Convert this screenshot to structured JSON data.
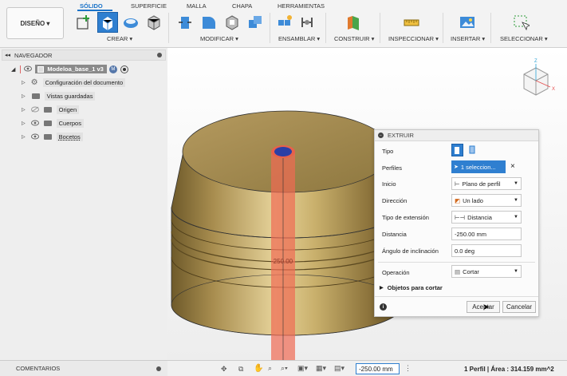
{
  "toolbar": {
    "workspace_label": "DISEÑO ▾",
    "tabs": [
      "SÓLIDO",
      "SUPERFICIE",
      "MALLA",
      "CHAPA",
      "HERRAMIENTAS"
    ],
    "groups": [
      "CREAR ▾",
      "MODIFICAR ▾",
      "ENSAMBLAR ▾",
      "CONSTRUIR ▾",
      "INSPECCIONAR ▾",
      "INSERTAR ▾",
      "SELECCIONAR ▾"
    ]
  },
  "navigator": {
    "title": "NAVEGADOR",
    "document_name": "Modeloa_base_1 v3",
    "items": [
      "Configuración del documento",
      "Vistas guardadas",
      "Origen",
      "Cuerpos",
      "Bocetos"
    ]
  },
  "extrude": {
    "title": "EXTRUIR",
    "rows": [
      {
        "label": "Tipo"
      },
      {
        "label": "Perfiles",
        "value": "1 seleccion..."
      },
      {
        "label": "Inicio",
        "value": "Plano de perfil"
      },
      {
        "label": "Dirección",
        "value": "Un lado"
      },
      {
        "label": "Tipo de extensión",
        "value": "Distancia"
      },
      {
        "label": "Distancia",
        "value": "-250.00 mm"
      },
      {
        "label": "Ángulo de inclinación",
        "value": "0.0 deg"
      },
      {
        "label": "Operación",
        "value": "Cortar"
      }
    ],
    "section": "Objetos para cortar",
    "accept": "Aceptar",
    "cancel": "Cancelar"
  },
  "viewport": {
    "dimension_label": "-250.00",
    "viewcube_labels": [
      "Z",
      "X"
    ]
  },
  "comments": "COMENTARIOS",
  "statusbar": {
    "input_value": "-250.00 mm",
    "status": "1 Perfil | Área : 314.159 mm^2"
  },
  "colors": {
    "accent": "#1a73c9",
    "cut_preview": "#f06a52",
    "model_gold": "#b59a5f"
  }
}
